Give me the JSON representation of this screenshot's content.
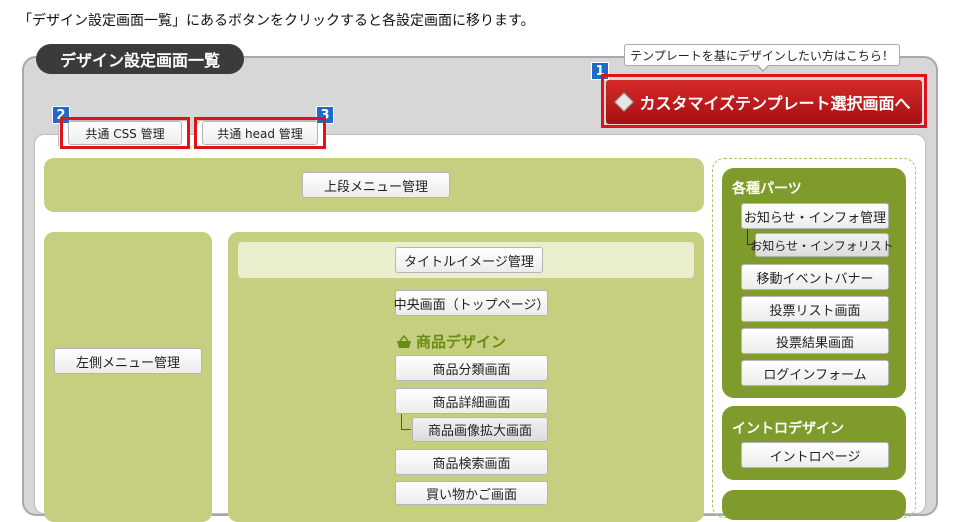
{
  "caption": "「デザイン設定画面一覧」にあるボタンをクリックすると各設定画面に移ります。",
  "panel": {
    "title": "デザイン設定画面一覧",
    "hint": "テンプレートを基にデザインしたい方はこちら！",
    "badges": {
      "b1": "1",
      "b2": "2",
      "b3": "3"
    },
    "custom_button": "カスタマイズテンプレート選択画面へ",
    "common_css": "共通 CSS 管理",
    "common_head": "共通 head 管理"
  },
  "layout": {
    "top_menu": "上段メニュー管理",
    "left_menu": "左側メニュー管理",
    "title_image": "タイトルイメージ管理",
    "center": "中央画面（トップページ）",
    "product_design": "商品デザイン",
    "product_buttons": {
      "category": "商品分類画面",
      "detail": "商品詳細画面",
      "image_zoom": "商品画像拡大画面",
      "search": "商品検索画面",
      "cart": "買い物かご画面"
    }
  },
  "sidebar": {
    "parts_title": "各種パーツ",
    "parts": {
      "info": "お知らせ・インフォ管理",
      "info_list": "お知らせ・インフォリスト",
      "event_banner": "移動イベントバナー",
      "vote_list": "投票リスト画面",
      "vote_result": "投票結果画面",
      "login": "ログインフォーム"
    },
    "intro_title": "イントロデザイン",
    "intro_page": "イントロページ"
  },
  "colors": {
    "accent_red": "#e1121a",
    "badge_blue": "#1e6cc8",
    "green": "#c6cf7f",
    "dark_green": "#7e9b2b"
  }
}
